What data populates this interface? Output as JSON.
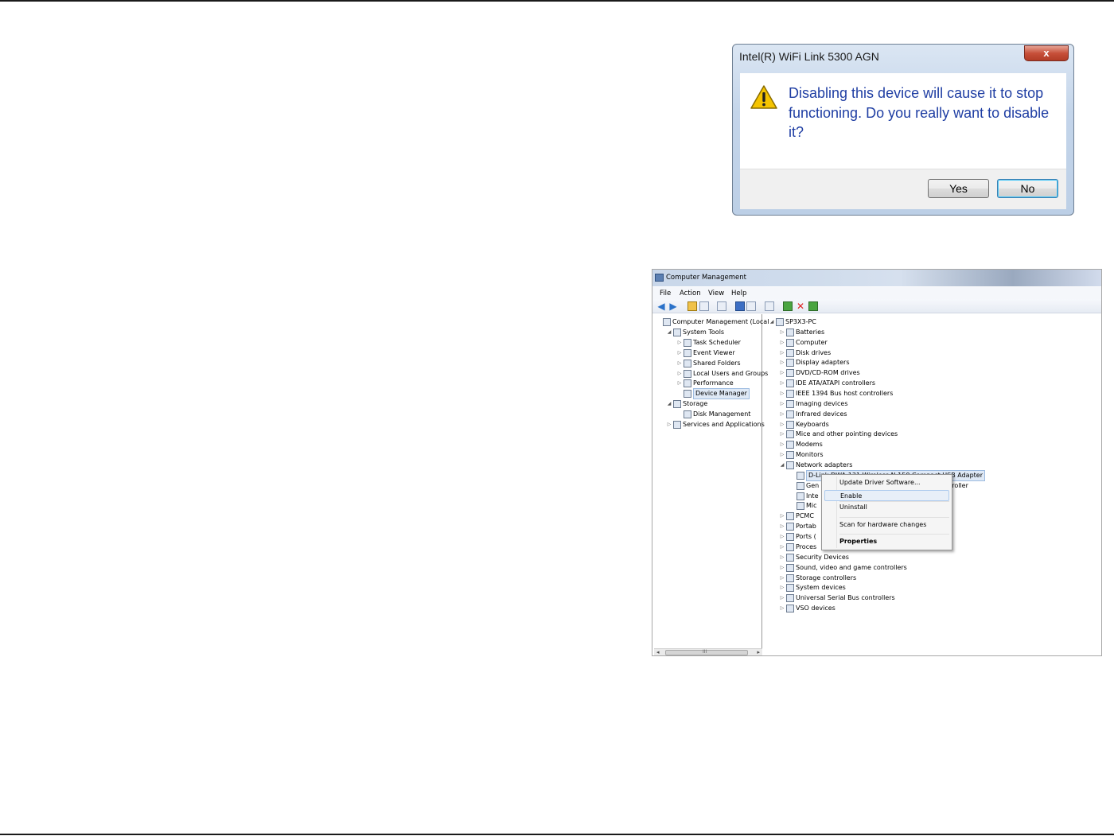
{
  "dialog": {
    "title": "Intel(R) WiFi Link 5300 AGN",
    "close": "x",
    "message": "Disabling this device will cause it to stop functioning. Do you really want to disable it?",
    "yes": "Yes",
    "no": "No"
  },
  "window": {
    "title": "Computer Management",
    "menu": [
      "File",
      "Action",
      "View",
      "Help"
    ],
    "left_tree": [
      {
        "label": "Computer Management (Local",
        "exp": "",
        "indent": 0
      },
      {
        "label": "System Tools",
        "exp": "◢",
        "indent": 1
      },
      {
        "label": "Task Scheduler",
        "exp": "▷",
        "indent": 2
      },
      {
        "label": "Event Viewer",
        "exp": "▷",
        "indent": 2
      },
      {
        "label": "Shared Folders",
        "exp": "▷",
        "indent": 2
      },
      {
        "label": "Local Users and Groups",
        "exp": "▷",
        "indent": 2
      },
      {
        "label": "Performance",
        "exp": "▷",
        "indent": 2
      },
      {
        "label": "Device Manager",
        "exp": "",
        "indent": 2,
        "selected": true
      },
      {
        "label": "Storage",
        "exp": "◢",
        "indent": 1
      },
      {
        "label": "Disk Management",
        "exp": "",
        "indent": 2
      },
      {
        "label": "Services and Applications",
        "exp": "▷",
        "indent": 1
      }
    ],
    "scroll_mark": "III",
    "right_tree": [
      {
        "label": "SP3X3-PC",
        "exp": "◢",
        "indent": 0
      },
      {
        "label": "Batteries",
        "exp": "▷",
        "indent": 1
      },
      {
        "label": "Computer",
        "exp": "▷",
        "indent": 1
      },
      {
        "label": "Disk drives",
        "exp": "▷",
        "indent": 1
      },
      {
        "label": "Display adapters",
        "exp": "▷",
        "indent": 1
      },
      {
        "label": "DVD/CD-ROM drives",
        "exp": "▷",
        "indent": 1
      },
      {
        "label": "IDE ATA/ATAPI controllers",
        "exp": "▷",
        "indent": 1
      },
      {
        "label": "IEEE 1394 Bus host controllers",
        "exp": "▷",
        "indent": 1
      },
      {
        "label": "Imaging devices",
        "exp": "▷",
        "indent": 1
      },
      {
        "label": "Infrared devices",
        "exp": "▷",
        "indent": 1
      },
      {
        "label": "Keyboards",
        "exp": "▷",
        "indent": 1
      },
      {
        "label": "Mice and other pointing devices",
        "exp": "▷",
        "indent": 1
      },
      {
        "label": "Modems",
        "exp": "▷",
        "indent": 1
      },
      {
        "label": "Monitors",
        "exp": "▷",
        "indent": 1
      },
      {
        "label": "Network adapters",
        "exp": "◢",
        "indent": 1
      },
      {
        "label": "D-Link DWA-131 Wireless N 150 Compact USB Adapter",
        "exp": "",
        "indent": 2,
        "selected": true
      },
      {
        "label": "Gen                                               hernet Controller",
        "exp": "",
        "indent": 2
      },
      {
        "label": "Inte",
        "exp": "",
        "indent": 2
      },
      {
        "label": "Mic",
        "exp": "",
        "indent": 2
      },
      {
        "label": "PCMC",
        "exp": "▷",
        "indent": 1
      },
      {
        "label": "Portab",
        "exp": "▷",
        "indent": 1
      },
      {
        "label": "Ports (",
        "exp": "▷",
        "indent": 1
      },
      {
        "label": "Proces",
        "exp": "▷",
        "indent": 1
      },
      {
        "label": "Security Devices",
        "exp": "▷",
        "indent": 1
      },
      {
        "label": "Sound, video and game controllers",
        "exp": "▷",
        "indent": 1
      },
      {
        "label": "Storage controllers",
        "exp": "▷",
        "indent": 1
      },
      {
        "label": "System devices",
        "exp": "▷",
        "indent": 1
      },
      {
        "label": "Universal Serial Bus controllers",
        "exp": "▷",
        "indent": 1
      },
      {
        "label": "VSO devices",
        "exp": "▷",
        "indent": 1
      }
    ]
  },
  "context_menu": {
    "items": [
      {
        "label": "Update Driver Software...",
        "bold": false,
        "highlight": false
      },
      {
        "label": "Enable",
        "bold": false,
        "highlight": true
      },
      {
        "label": "Uninstall",
        "bold": false,
        "highlight": false
      },
      {
        "label": "Scan for hardware changes",
        "bold": false,
        "highlight": false
      },
      {
        "label": "Properties",
        "bold": true,
        "highlight": false
      }
    ]
  }
}
